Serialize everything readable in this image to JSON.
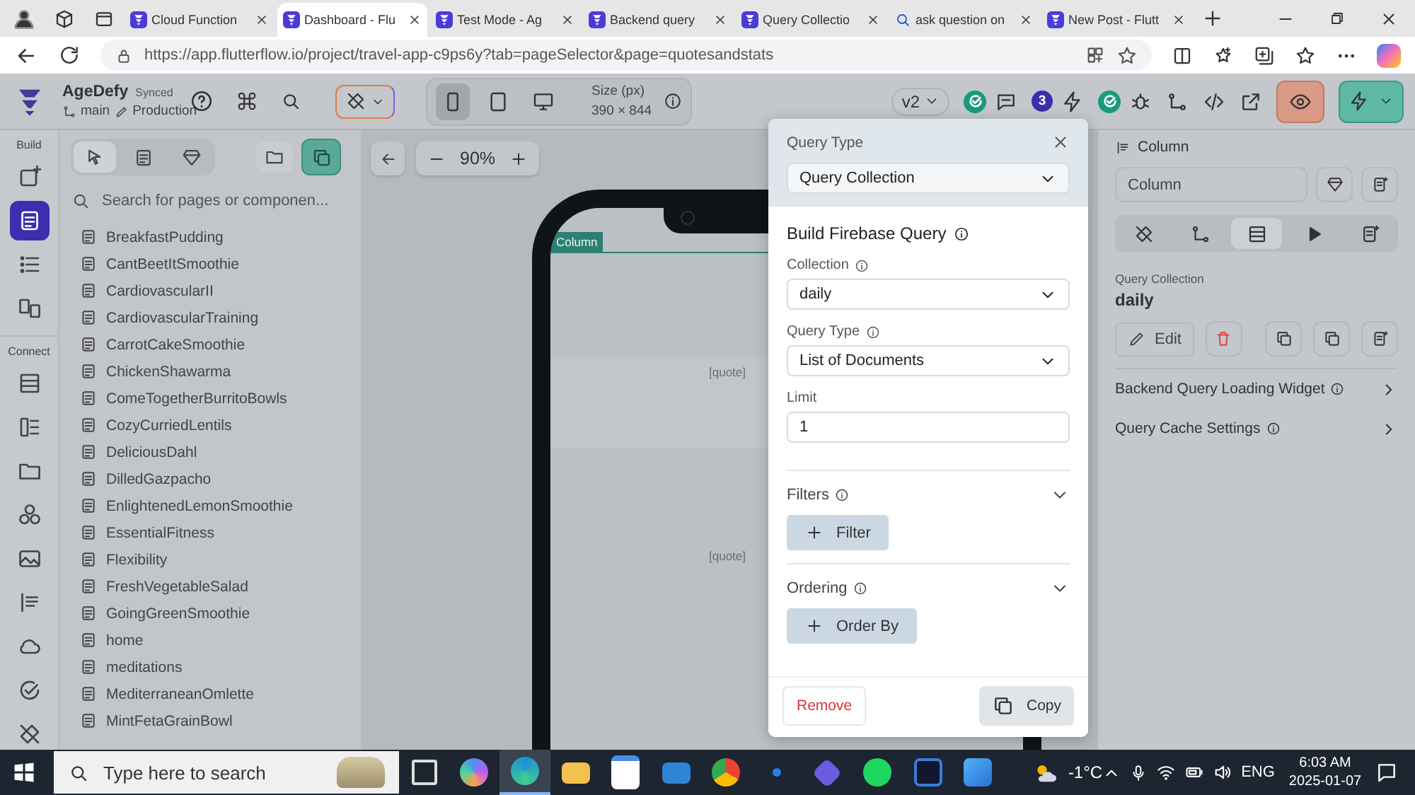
{
  "browser": {
    "tabs": [
      {
        "kind": "app",
        "title": "Cloud Function",
        "selected": false
      },
      {
        "kind": "app",
        "title": "Dashboard - Flu",
        "selected": true
      },
      {
        "kind": "app",
        "title": "Test Mode - Ag",
        "selected": false
      },
      {
        "kind": "app",
        "title": "Backend query",
        "selected": false
      },
      {
        "kind": "app",
        "title": "Query Collectio",
        "selected": false
      },
      {
        "kind": "search",
        "title": "ask question on",
        "selected": false
      },
      {
        "kind": "app",
        "title": "New Post - Flutt",
        "selected": false
      }
    ],
    "url": "https://app.flutterflow.io/project/travel-app-c9ps6y?tab=pageSelector&page=quotesandstats"
  },
  "toolbar": {
    "project": "AgeDefy",
    "sync_status": "Synced",
    "branch": "main",
    "environment": "Production",
    "devices": [
      {
        "kind": "phone",
        "selected": true
      },
      {
        "kind": "tablet",
        "selected": false
      },
      {
        "kind": "desktop",
        "selected": false
      }
    ],
    "size_label": "Size (px)",
    "size_value": "390 × 844",
    "version": "v2",
    "badge": "3"
  },
  "rail": {
    "sections": [
      {
        "label": "Build",
        "items": [
          {
            "kind": "add-widget",
            "selected": false
          },
          {
            "kind": "pages",
            "selected": true
          },
          {
            "kind": "list",
            "selected": false
          },
          {
            "kind": "storyboard",
            "selected": false
          }
        ]
      },
      {
        "label": "Connect",
        "items": [
          {
            "kind": "database",
            "selected": false
          },
          {
            "kind": "api",
            "selected": false
          },
          {
            "kind": "folder",
            "selected": false
          },
          {
            "kind": "nodes",
            "selected": false
          },
          {
            "kind": "image",
            "selected": false
          },
          {
            "kind": "text",
            "selected": false
          },
          {
            "kind": "cloud",
            "selected": false
          },
          {
            "kind": "check",
            "selected": false
          },
          {
            "kind": "style",
            "selected": false
          }
        ]
      }
    ]
  },
  "pages": {
    "views": [
      {
        "kind": "widgets",
        "selected": true
      },
      {
        "kind": "pages",
        "selected": false
      },
      {
        "kind": "theme",
        "selected": false
      }
    ],
    "search_placeholder": "Search for pages or componen...",
    "items": [
      "BreakfastPudding",
      "CantBeetItSmoothie",
      "CardiovascularII",
      "CardiovascularTraining",
      "CarrotCakeSmoothie",
      "ChickenShawarma",
      "ComeTogetherBurritoBowls",
      "CozyCurriedLentils",
      "DeliciousDahl",
      "DilledGazpacho",
      "EnlightenedLemonSmoothie",
      "EssentialFitness",
      "Flexibility",
      "FreshVegetableSalad",
      "GoingGreenSmoothie",
      "home",
      "meditations",
      "MediterraneanOmlette",
      "MintFetaGrainBowl"
    ]
  },
  "canvas": {
    "zoom": "90%",
    "selected_widget": "Column",
    "quotes": [
      "[quote]",
      "[quote]"
    ]
  },
  "popup": {
    "header_label": "Query Type",
    "query_type": "Query Collection",
    "title": "Build Firebase Query",
    "fields": [
      {
        "kind": "select",
        "label": "Collection",
        "info": true,
        "value": "daily"
      },
      {
        "kind": "select",
        "label": "Query Type",
        "info": true,
        "value": "List of Documents"
      },
      {
        "kind": "text",
        "label": "Limit",
        "info": false,
        "value": "1"
      }
    ],
    "groups": [
      {
        "title": "Filters",
        "button": "Filter"
      },
      {
        "title": "Ordering",
        "button": "Order By"
      }
    ],
    "remove": "Remove",
    "copy": "Copy"
  },
  "panel": {
    "title": "Column",
    "name_value": "Column",
    "tabs": [
      {
        "kind": "style",
        "selected": false
      },
      {
        "kind": "actions",
        "selected": false
      },
      {
        "kind": "query",
        "selected": true
      },
      {
        "kind": "play",
        "selected": false
      },
      {
        "kind": "docs",
        "selected": false
      }
    ],
    "query_label": "Query Collection",
    "query_value": "daily",
    "edit": "Edit",
    "rows": [
      "Backend Query Loading Widget",
      "Query Cache Settings"
    ]
  },
  "taskbar": {
    "search_placeholder": "Type here to search",
    "apps": [
      {
        "kind": "taskview",
        "selected": false
      },
      {
        "kind": "swirl",
        "selected": false
      },
      {
        "kind": "browser",
        "selected": true
      },
      {
        "kind": "folder",
        "selected": false
      },
      {
        "kind": "bag",
        "selected": false
      },
      {
        "kind": "mail",
        "selected": false
      },
      {
        "kind": "circle",
        "selected": false
      },
      {
        "kind": "dot",
        "selected": false
      },
      {
        "kind": "hex",
        "selected": false
      },
      {
        "kind": "waves",
        "selected": false
      },
      {
        "kind": "w",
        "selected": false
      },
      {
        "kind": "photo",
        "selected": false
      }
    ],
    "temperature": "-1°C",
    "language": "ENG",
    "time": "6:03 AM",
    "date": "2025-01-07"
  }
}
